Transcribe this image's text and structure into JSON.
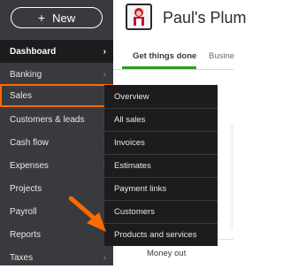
{
  "new_button": {
    "label": "New",
    "icon": "plus-icon"
  },
  "sidebar": {
    "items": [
      {
        "label": "Dashboard",
        "active": true
      },
      {
        "label": "Banking"
      },
      {
        "label": "Sales",
        "highlighted": true
      },
      {
        "label": "Customers & leads"
      },
      {
        "label": "Cash flow"
      },
      {
        "label": "Expenses"
      },
      {
        "label": "Projects"
      },
      {
        "label": "Payroll"
      },
      {
        "label": "Reports"
      },
      {
        "label": "Taxes"
      }
    ],
    "chevron": "›"
  },
  "header": {
    "company_name": "Paul's Plum",
    "logo_icon": "plumber-logo-icon"
  },
  "tabs": [
    {
      "label": "Get things done",
      "active": true
    },
    {
      "label": "Busine"
    }
  ],
  "sales_menu": {
    "items": [
      "Overview",
      "All sales",
      "Invoices",
      "Estimates",
      "Payment links",
      "Customers",
      "Products and services"
    ]
  },
  "main": {
    "card_label": "Money out"
  },
  "colors": {
    "sidebar_bg": "#393a3d",
    "active_bg": "#1c1c1e",
    "highlight": "#ff6a00",
    "tab_accent": "#2ca01c"
  }
}
